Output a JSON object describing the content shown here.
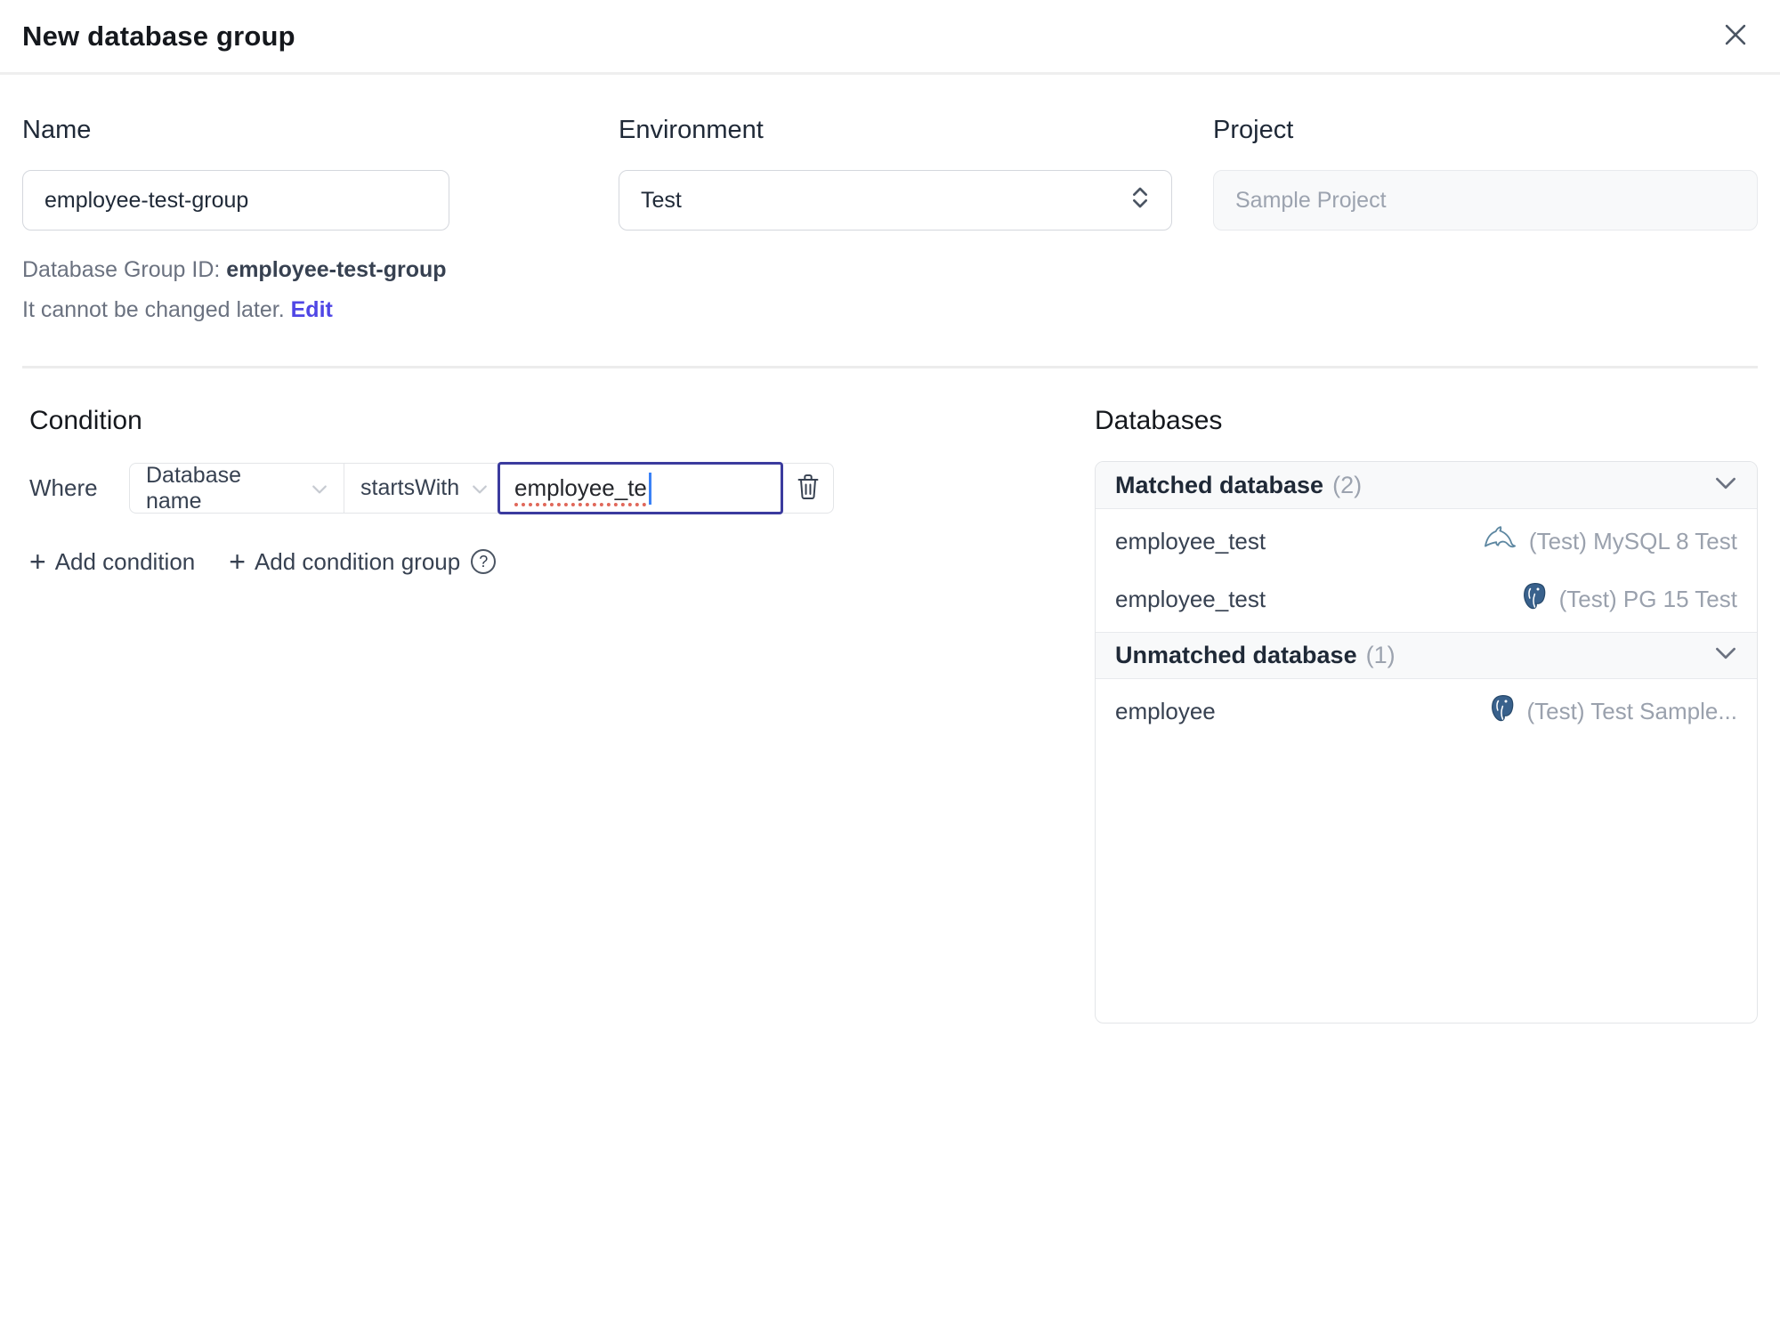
{
  "dialog": {
    "title": "New database group"
  },
  "form": {
    "name": {
      "label": "Name",
      "value": "employee-test-group"
    },
    "environment": {
      "label": "Environment",
      "value": "Test"
    },
    "project": {
      "label": "Project",
      "value": "Sample Project"
    },
    "id_note": {
      "prefix": "Database Group ID: ",
      "id": "employee-test-group",
      "suffix": " It cannot be changed later. ",
      "edit_label": "Edit"
    }
  },
  "condition": {
    "heading": "Condition",
    "where_label": "Where",
    "field": "Database name",
    "operator": "startsWith",
    "value": "employee_te",
    "add_condition_label": "Add condition",
    "add_condition_group_label": "Add condition group",
    "help_glyph": "?"
  },
  "databases": {
    "heading": "Databases",
    "sections": [
      {
        "title": "Matched database",
        "count": "(2)",
        "rows": [
          {
            "name": "employee_test",
            "engine": "mysql",
            "instance": "(Test) MySQL 8 Test"
          },
          {
            "name": "employee_test",
            "engine": "postgres",
            "instance": "(Test) PG 15 Test"
          }
        ]
      },
      {
        "title": "Unmatched database",
        "count": "(1)",
        "rows": [
          {
            "name": "employee",
            "engine": "postgres",
            "instance": "(Test) Test Sample..."
          }
        ]
      }
    ]
  },
  "colors": {
    "accent_link": "#4f46e5",
    "focus_border": "#3b3b9e",
    "spellcheck_underline": "#e0685a",
    "mysql_icon": "#5d87a1",
    "postgres_icon": "#39618c",
    "header_bg": "#f8f9fa"
  }
}
